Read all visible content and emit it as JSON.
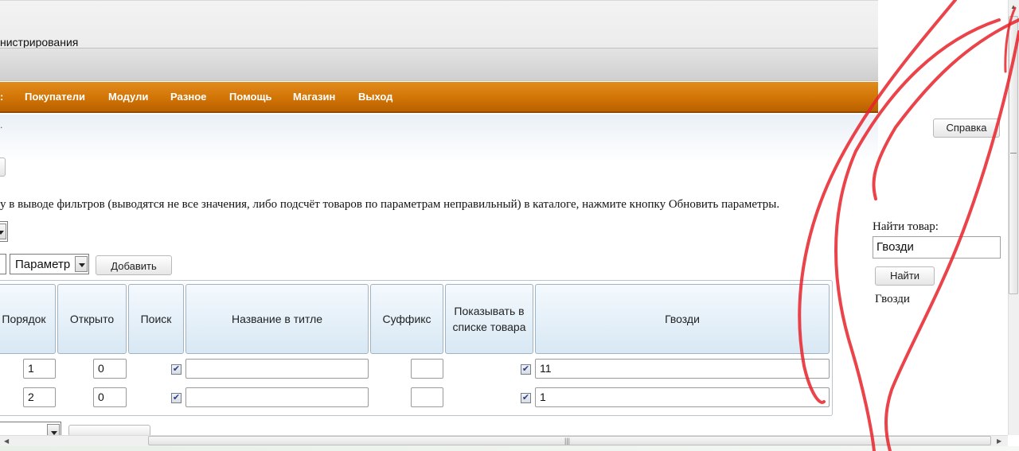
{
  "header": {
    "admin_title": "нистрирования"
  },
  "nav": {
    "items": [
      "Покупатели",
      "Модули",
      "Разное",
      "Помощь",
      "Магазин",
      "Выход"
    ]
  },
  "toolbar": {
    "help_button": "Справка",
    "add_button": "Добавить"
  },
  "notice_text": "у в выводе фильтров (выводятся не все значения, либо подсчёт товаров по параметрам неправильный) в каталоге, нажмите кнопку Обновить параметры.",
  "param_select": {
    "selected": "Параметр"
  },
  "table": {
    "headers": [
      "Порядок",
      "Открыто",
      "Поиск",
      "Название в титле",
      "Суффикс",
      "Показывать в списке товара",
      "Гвозди"
    ],
    "rows": [
      {
        "order": "1",
        "open": "0",
        "search_checked": true,
        "title_name": "",
        "suffix": "",
        "show_in_list": true,
        "value": "11"
      },
      {
        "order": "2",
        "open": "0",
        "search_checked": true,
        "title_name": "",
        "suffix": "",
        "show_in_list": true,
        "value": "1"
      }
    ]
  },
  "search_panel": {
    "label": "Найти товар:",
    "input_value": "Гвозди",
    "find_button": "Найти",
    "result": "Гвозди"
  },
  "colors": {
    "nav_orange": "#d27406",
    "header_blue": "#d8e8f4",
    "annotation_red": "#e8222a"
  },
  "icons": {
    "check": "checkbox-checked-icon",
    "dropdown": "chevron-down-icon",
    "grip": "scroll-grip-icon"
  }
}
